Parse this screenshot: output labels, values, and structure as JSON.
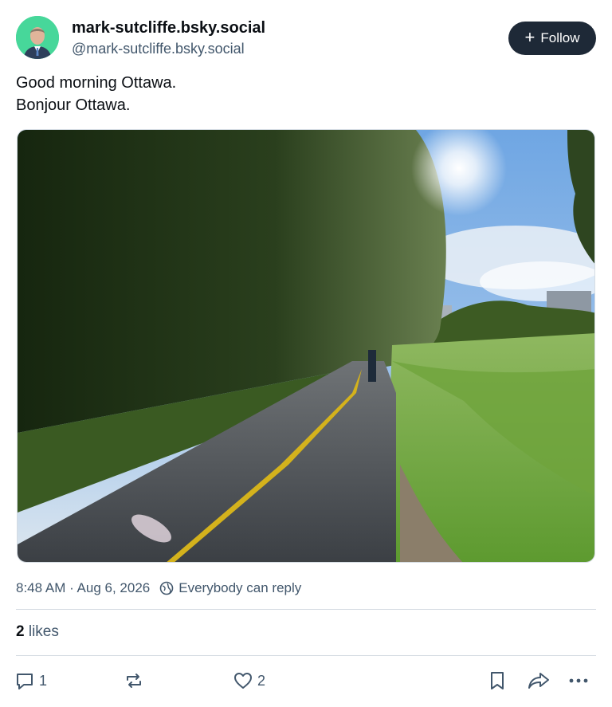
{
  "author": {
    "display_name": "mark-sutcliffe.bsky.social",
    "handle": "@mark-sutcliffe.bsky.social",
    "avatar_icon": "person-avatar"
  },
  "follow_button": {
    "label": "Follow",
    "icon": "plus-icon"
  },
  "post": {
    "lines": [
      "Good morning Ottawa.",
      "Bonjour Ottawa."
    ],
    "image_icon": "photo-bike-path"
  },
  "meta": {
    "timestamp": "8:48 AM · Aug 6, 2026",
    "reply_setting": "Everybody can reply"
  },
  "likes": {
    "count": "2",
    "label": "likes"
  },
  "actions": {
    "reply_count": "1",
    "repost_count": "",
    "like_count": "2"
  },
  "colors": {
    "accent_dark": "#1e2937",
    "muted_text": "#42576c",
    "avatar_bg": "#47d79a"
  }
}
